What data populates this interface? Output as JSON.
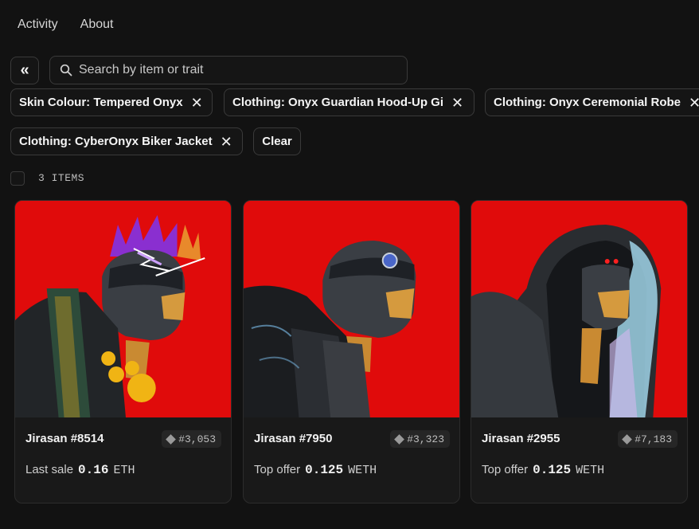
{
  "nav": {
    "activity": "Activity",
    "about": "About"
  },
  "collapse_icon": "double-chevron-left-icon",
  "search": {
    "placeholder": "Search by item or trait",
    "value": ""
  },
  "filters": [
    {
      "label": "Skin Colour: Tempered Onyx"
    },
    {
      "label": "Clothing: Onyx Guardian Hood-Up Gi"
    },
    {
      "label": "Clothing: Onyx Ceremonial Robe"
    },
    {
      "label": "Clothing: CyberOnyx Biker Jacket"
    }
  ],
  "clear_label": "Clear",
  "item_count": "3 ITEMS",
  "cards": [
    {
      "name": "Jirasan #8514",
      "rank": "#3,053",
      "price_label": "Last sale",
      "price": "0.16",
      "currency": "ETH"
    },
    {
      "name": "Jirasan #7950",
      "rank": "#3,323",
      "price_label": "Top offer",
      "price": "0.125",
      "currency": "WETH"
    },
    {
      "name": "Jirasan #2955",
      "rank": "#7,183",
      "price_label": "Top offer",
      "price": "0.125",
      "currency": "WETH"
    }
  ],
  "colors": {
    "background": "#121212",
    "card_art_bg": "#e00b0b",
    "border": "#3a3a3a"
  }
}
